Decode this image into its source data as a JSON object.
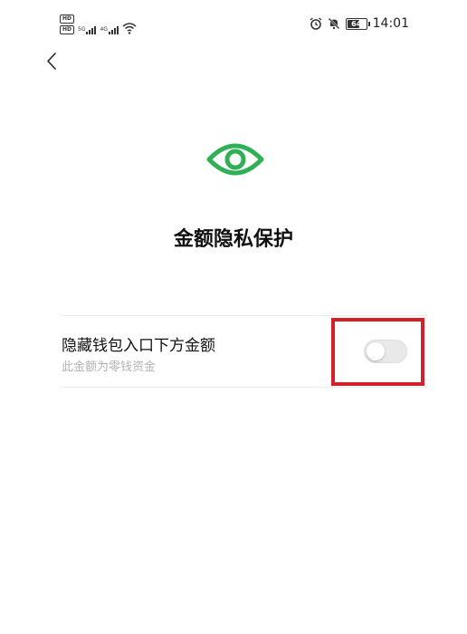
{
  "status_bar": {
    "left_signal_1_label": "5G",
    "left_signal_2_label": "4G",
    "hd_badge": "HD",
    "battery_level": "64",
    "time": "14:01",
    "icons": [
      "alarm-icon",
      "mute-icon",
      "battery-icon",
      "wifi-icon"
    ]
  },
  "header": {
    "back_icon": "chevron-left-icon"
  },
  "hero": {
    "icon": "eye-icon",
    "icon_color": "#2fb054",
    "title": "金额隐私保护"
  },
  "setting": {
    "title": "隐藏钱包入口下方金额",
    "subtitle": "此金额为零钱资金",
    "toggle_on": false
  },
  "annotation": {
    "color": "#d4202a"
  }
}
